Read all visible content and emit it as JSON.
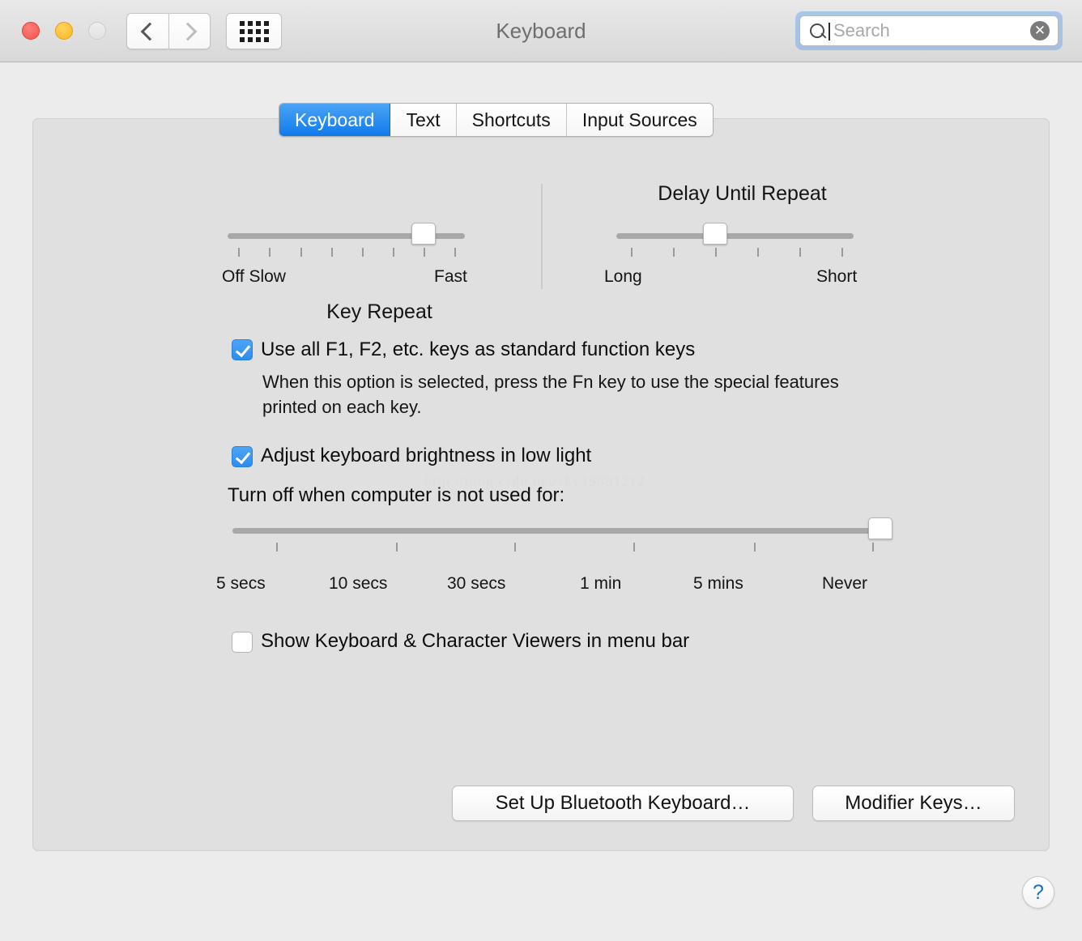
{
  "window": {
    "title": "Keyboard",
    "traffic_lights": [
      {
        "name": "close",
        "color": "#f4534b"
      },
      {
        "name": "minimize",
        "color": "#fbb722"
      },
      {
        "name": "zoom",
        "color": "#e2e2e2"
      }
    ],
    "nav_back_icon": "chevron-left-icon",
    "nav_forward_icon": "chevron-right-icon",
    "grid_icon": "show-all-grid-icon"
  },
  "search": {
    "placeholder": "Search",
    "value": "",
    "icon": "search-icon",
    "clear_icon": "✕"
  },
  "tabs": [
    {
      "label": "Keyboard",
      "active": true
    },
    {
      "label": "Text",
      "active": false
    },
    {
      "label": "Shortcuts",
      "active": false
    },
    {
      "label": "Input Sources",
      "active": false
    }
  ],
  "key_repeat": {
    "title": "Key Repeat",
    "left_label": "Off Slow",
    "right_label": "Fast",
    "ticks": 8,
    "value_index": 6
  },
  "delay_until_repeat": {
    "title": "Delay Until Repeat",
    "left_label": "Long",
    "right_label": "Short",
    "ticks": 6,
    "value_index": 2
  },
  "function_keys": {
    "label": "Use all F1, F2, etc. keys as standard function keys",
    "checked": true,
    "description": "When this option is selected, press the Fn key to use the special features printed on each key."
  },
  "brightness": {
    "label": "Adjust keyboard brightness in low light",
    "checked": true,
    "timeout_label": "Turn off when computer is not used for:",
    "timeout_options": [
      "5 secs",
      "10 secs",
      "30 secs",
      "1 min",
      "5 mins",
      "Never"
    ],
    "timeout_value": "Never",
    "timeout_value_index": 5
  },
  "viewers": {
    "label": "Show Keyboard & Character Viewers in menu bar",
    "checked": false
  },
  "buttons": {
    "bluetooth": "Set Up Bluetooth Keyboard…",
    "modifier": "Modifier Keys…"
  },
  "help": {
    "glyph": "?"
  },
  "watermark": "http://blog.csdn.net/sky19891212"
}
